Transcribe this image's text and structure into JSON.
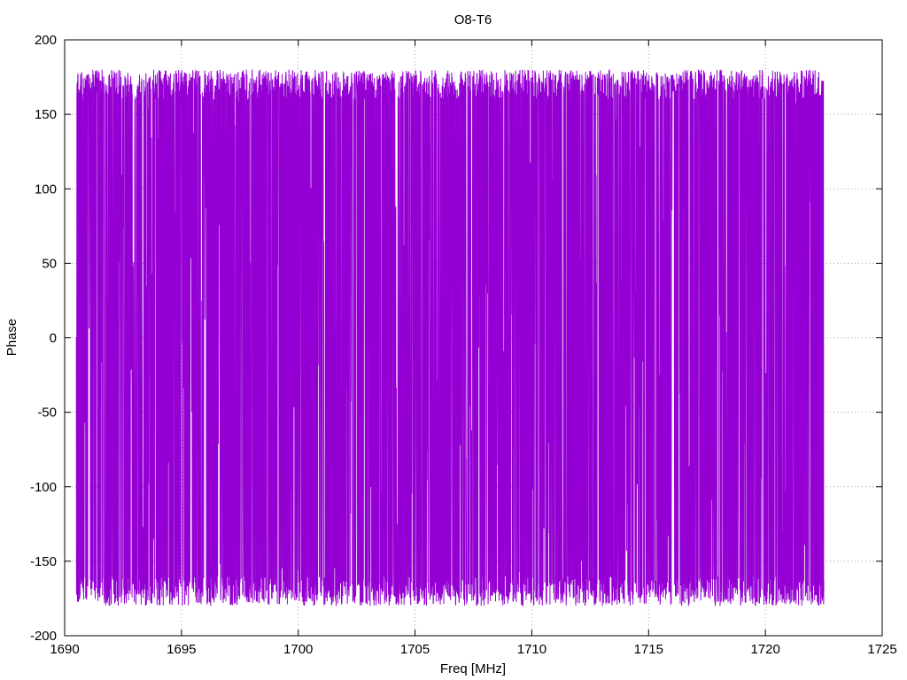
{
  "chart_data": {
    "type": "line",
    "title": "O8-T6",
    "xlabel": "Freq [MHz]",
    "ylabel": "Phase",
    "xlim": [
      1690,
      1725
    ],
    "ylim": [
      -200,
      200
    ],
    "xticks": [
      1690,
      1695,
      1700,
      1705,
      1710,
      1715,
      1720,
      1725
    ],
    "yticks": [
      -200,
      -150,
      -100,
      -50,
      0,
      50,
      100,
      150,
      200
    ],
    "grid": true,
    "color": "#9400d3",
    "series": [
      {
        "x_start": 1690.5,
        "x_end": 1722.5,
        "samples": 4000,
        "y_range": [
          -180,
          180
        ],
        "pattern": "wrapped phase, noise-like oscillation spanning the full range"
      }
    ]
  }
}
